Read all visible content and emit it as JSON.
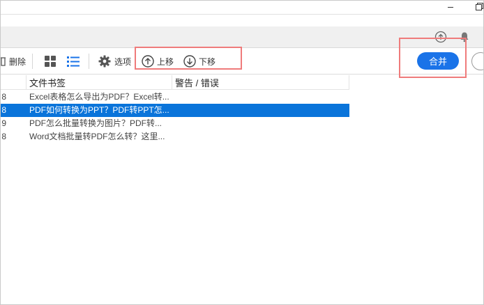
{
  "toolbar": {
    "delete_label": "删除",
    "options_label": "选项",
    "move_up_label": "上移",
    "move_down_label": "下移",
    "merge_label": "合并"
  },
  "table": {
    "columns": [
      "文件书签",
      "警告 / 错误"
    ],
    "rows": [
      {
        "num": "8",
        "name": "Excel表格怎么导出为PDF？Excel转...",
        "warning": "",
        "selected": false
      },
      {
        "num": "8",
        "name": "PDF如何转换为PPT？PDF转PPT怎...",
        "warning": "",
        "selected": true
      },
      {
        "num": "9",
        "name": "PDF怎么批量转换为图片？PDF转...",
        "warning": "",
        "selected": false
      },
      {
        "num": "8",
        "name": "Word文档批量转PDF怎么转？这里...",
        "warning": "",
        "selected": false
      }
    ]
  },
  "colors": {
    "accent": "#1a73e8",
    "selection": "#0a74da",
    "highlight": "#ef7b7b"
  }
}
